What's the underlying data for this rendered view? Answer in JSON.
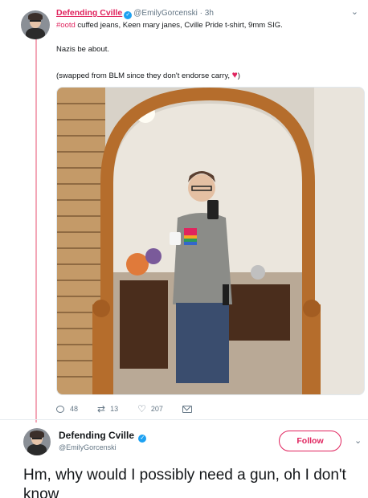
{
  "tweet1": {
    "name": "Defending Cville",
    "handle": "@EmilyGorcenski",
    "time": "· 3h",
    "hashtag": "#ootd",
    "line1": " cuffed jeans, Keen mary janes, Cville Pride t-shirt, 9mm SIG.",
    "line2": "Nazis be about.",
    "line3": "(swapped from BLM since they don't endorse carry, ",
    "line3_end": ")",
    "replies": "48",
    "retweets": "13",
    "likes": "207"
  },
  "tweet2": {
    "name": "Defending Cville",
    "handle": "@EmilyGorcenski",
    "follow_label": "Follow",
    "text": "Hm, why would I possibly need a gun, oh I don't know"
  },
  "colors": {
    "accent": "#e0245e",
    "verified": "#1da1f2",
    "muted": "#657786",
    "thread_line": "#f3a7b7"
  },
  "icons": [
    "verified-badge-icon",
    "chevron-down-icon",
    "reply-icon",
    "retweet-icon",
    "heart-icon",
    "mail-icon"
  ]
}
